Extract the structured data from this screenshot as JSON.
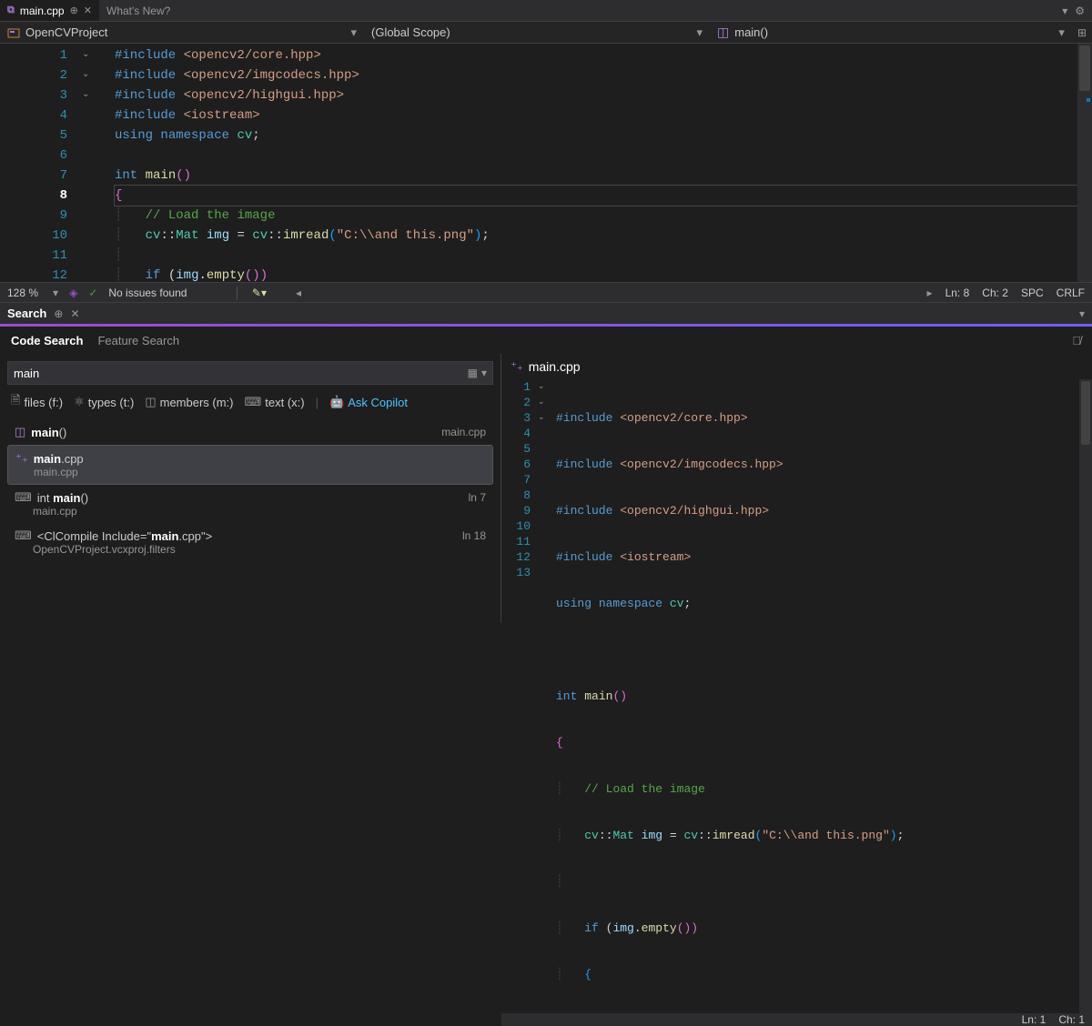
{
  "tabs": {
    "active": {
      "name": "main.cpp"
    },
    "other": {
      "name": "What's New?"
    }
  },
  "navbar": {
    "project": "OpenCVProject",
    "scope": "(Global Scope)",
    "function": "main()"
  },
  "editor": {
    "lines": [
      "1",
      "2",
      "3",
      "4",
      "5",
      "6",
      "7",
      "8",
      "9",
      "10",
      "11",
      "12"
    ],
    "code": {
      "l1a": "#include",
      "l1b": "<opencv2/core.hpp>",
      "l2a": "#include",
      "l2b": "<opencv2/imgcodecs.hpp>",
      "l3a": "#include",
      "l3b": "<opencv2/highgui.hpp>",
      "l4a": "#include",
      "l4b": "<iostream>",
      "l5a": "using",
      "l5b": "namespace",
      "l5c": "cv",
      "l7a": "int",
      "l7b": "main",
      "l7c": "()",
      "l8a": "{",
      "l9a": "// Load the image",
      "l10a": "cv",
      "l10b": "::",
      "l10c": "Mat",
      "l10d": "img",
      "l10e": " = ",
      "l10f": "cv",
      "l10g": "::",
      "l10h": "imread",
      "l10i": "(",
      "l10j": "\"C:\\\\and this.png\"",
      "l10k": ")",
      "l10l": ";",
      "l12a": "if",
      "l12b": " (",
      "l12c": "img",
      "l12d": ".",
      "l12e": "empty",
      "l12f": "())"
    }
  },
  "status": {
    "zoom": "128 %",
    "issues": "No issues found",
    "ln": "Ln: 8",
    "ch": "Ch: 2",
    "spc": "SPC",
    "crlf": "CRLF"
  },
  "search": {
    "panel_title": "Search",
    "tab1": "Code Search",
    "tab2": "Feature Search",
    "query": "main",
    "filters": {
      "files": "files (f:)",
      "types": "types (t:)",
      "members": "members (m:)",
      "text": "text (x:)",
      "copilot": "Ask Copilot"
    },
    "results": {
      "r0": {
        "title_pre": "",
        "title_bold": "main",
        "title_post": "()",
        "sub": "main.cpp",
        "ln": ""
      },
      "r1": {
        "title_pre": "",
        "title_bold": "main",
        "title_post": ".cpp",
        "sub": "main.cpp",
        "ln": ""
      },
      "r2": {
        "title_pre": "int ",
        "title_bold": "main",
        "title_post": "()",
        "sub": "main.cpp",
        "ln": "ln 7"
      },
      "r3": {
        "title_pre": "<ClCompile Include=\"",
        "title_bold": "main",
        "title_post": ".cpp\">",
        "sub": "OpenCVProject.vcxproj.filters",
        "ln": "ln 18"
      }
    }
  },
  "preview": {
    "filename": "main.cpp",
    "lines": [
      "1",
      "2",
      "3",
      "4",
      "5",
      "6",
      "7",
      "8",
      "9",
      "10",
      "11",
      "12",
      "13"
    ],
    "status_ln": "Ln: 1",
    "status_ch": "Ch: 1"
  }
}
